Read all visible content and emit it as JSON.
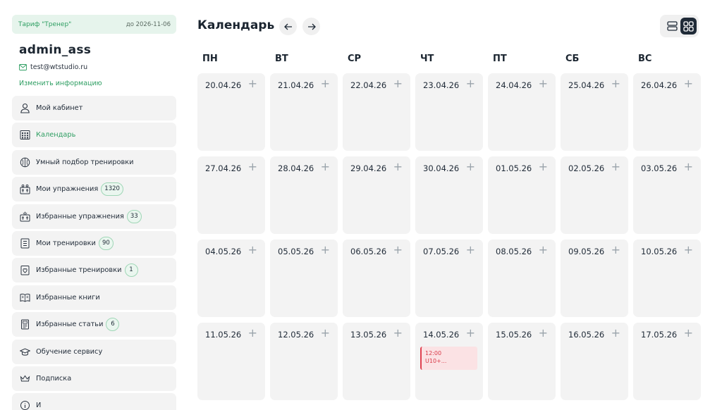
{
  "sidebar": {
    "plan": {
      "name": "Тариф \"Тренер\"",
      "until": "до 2026-11-06"
    },
    "username": "admin_ass",
    "email": "test@wtstudio.ru",
    "edit_link": "Изменить информацию",
    "items": [
      {
        "label": "Мой кабинет",
        "icon": "user-icon",
        "badge": null
      },
      {
        "label": "Календарь",
        "icon": "calendar-icon",
        "badge": null,
        "active": true
      },
      {
        "label": "Умный подбор тренировки",
        "icon": "brain-icon",
        "badge": null
      },
      {
        "label": "Мои упражнения",
        "icon": "exercise-icon",
        "badge": "1320"
      },
      {
        "label": "Избранные упражнения",
        "icon": "favorite-exercise-icon",
        "badge": "33"
      },
      {
        "label": "Мои тренировки",
        "icon": "workout-list-icon",
        "badge": "90"
      },
      {
        "label": "Избранные тренировки",
        "icon": "favorite-workout-icon",
        "badge": "1"
      },
      {
        "label": "Избранные книги",
        "icon": "book-icon",
        "badge": null
      },
      {
        "label": "Избранные статьи",
        "icon": "article-icon",
        "badge": "6"
      },
      {
        "label": "Обучение сервису",
        "icon": "graduation-cap-icon",
        "badge": null
      },
      {
        "label": "Подписка",
        "icon": "crown-icon",
        "badge": null
      },
      {
        "label": "И",
        "icon": "info-icon",
        "badge": null
      }
    ]
  },
  "calendar": {
    "title": "Календарь",
    "days": [
      "ПН",
      "ВТ",
      "СР",
      "ЧТ",
      "ПТ",
      "СБ",
      "ВС"
    ],
    "add_symbol": "+",
    "weeks": [
      [
        "20.04.26",
        "21.04.26",
        "22.04.26",
        "23.04.26",
        "24.04.26",
        "25.04.26",
        "26.04.26"
      ],
      [
        "27.04.26",
        "28.04.26",
        "29.04.26",
        "30.04.26",
        "01.05.26",
        "02.05.26",
        "03.05.26"
      ],
      [
        "04.05.26",
        "05.05.26",
        "06.05.26",
        "07.05.26",
        "08.05.26",
        "09.05.26",
        "10.05.26"
      ],
      [
        "11.05.26",
        "12.05.26",
        "13.05.26",
        "14.05.26",
        "15.05.26",
        "16.05.26",
        "17.05.26"
      ]
    ],
    "events": [
      {
        "date": "14.05.26",
        "time": "12:00",
        "title": "U10+..."
      }
    ],
    "colors": {
      "accent": "#2e9e62",
      "event_bg": "#fbe2e4",
      "event_text": "#d93a49",
      "cell_bg": "#f3f3f3"
    }
  }
}
